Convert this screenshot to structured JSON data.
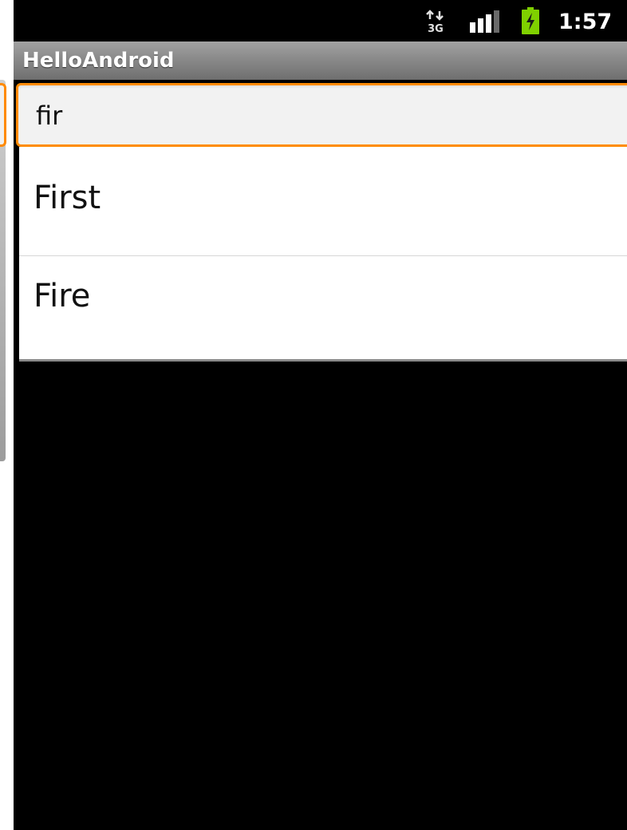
{
  "status_bar": {
    "network_type": "3G",
    "time": "1:57",
    "icons": {
      "data": "3g-data-icon",
      "signal": "signal-strength-icon",
      "battery": "battery-charging-icon"
    },
    "colors": {
      "battery": "#7fd000",
      "signal_strong": "#ffffff",
      "signal_weak": "#6a6a6a"
    }
  },
  "title_bar": {
    "title": "HelloAndroid"
  },
  "autocomplete": {
    "input_value": "fir",
    "focus_color": "#ff8c00",
    "suggestions": [
      {
        "label": "First"
      },
      {
        "label": "Fire"
      }
    ]
  }
}
